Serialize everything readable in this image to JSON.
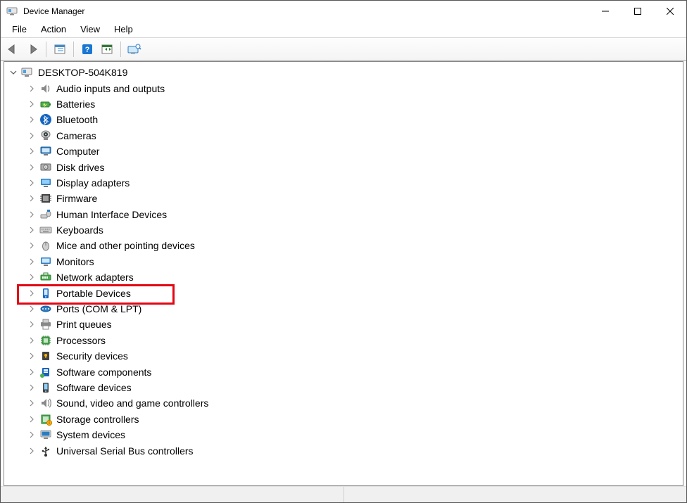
{
  "window": {
    "title": "Device Manager"
  },
  "menu": {
    "file": "File",
    "action": "Action",
    "view": "View",
    "help": "Help"
  },
  "toolbar": {
    "back": "back-icon",
    "forward": "forward-icon",
    "show_hidden": "show-hidden-icon",
    "help_btn": "help-icon",
    "scan": "scan-icon",
    "props": "properties-icon"
  },
  "tree": {
    "root": {
      "label": "DESKTOP-504K819"
    },
    "items": [
      {
        "id": "audio",
        "label": "Audio inputs and outputs"
      },
      {
        "id": "batt",
        "label": "Batteries"
      },
      {
        "id": "bt",
        "label": "Bluetooth"
      },
      {
        "id": "cam",
        "label": "Cameras"
      },
      {
        "id": "comp",
        "label": "Computer"
      },
      {
        "id": "disk",
        "label": "Disk drives"
      },
      {
        "id": "disp",
        "label": "Display adapters"
      },
      {
        "id": "fw",
        "label": "Firmware"
      },
      {
        "id": "hid",
        "label": "Human Interface Devices"
      },
      {
        "id": "kb",
        "label": "Keyboards"
      },
      {
        "id": "mouse",
        "label": "Mice and other pointing devices"
      },
      {
        "id": "mon",
        "label": "Monitors"
      },
      {
        "id": "net",
        "label": "Network adapters"
      },
      {
        "id": "port",
        "label": "Portable Devices",
        "highlighted": true
      },
      {
        "id": "ports",
        "label": "Ports (COM & LPT)"
      },
      {
        "id": "prn",
        "label": "Print queues"
      },
      {
        "id": "proc",
        "label": "Processors"
      },
      {
        "id": "sec",
        "label": "Security devices"
      },
      {
        "id": "swc",
        "label": "Software components"
      },
      {
        "id": "swd",
        "label": "Software devices"
      },
      {
        "id": "snd",
        "label": "Sound, video and game controllers"
      },
      {
        "id": "stor",
        "label": "Storage controllers"
      },
      {
        "id": "sys",
        "label": "System devices"
      },
      {
        "id": "usb",
        "label": "Universal Serial Bus controllers"
      }
    ]
  }
}
